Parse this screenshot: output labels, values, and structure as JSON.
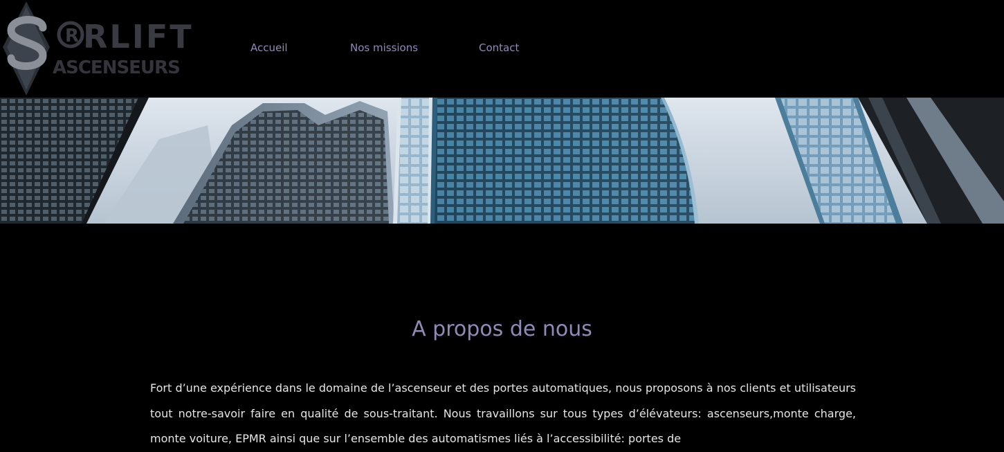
{
  "logo": {
    "name_top": "RLIFT",
    "name_bottom": "ASCENSEURS"
  },
  "nav": {
    "items": [
      {
        "label": "Accueil"
      },
      {
        "label": "Nos missions"
      },
      {
        "label": "Contact"
      }
    ]
  },
  "about": {
    "title": "A propos de nous",
    "paragraph": "Fort d’une expérience dans le domaine de l’ascenseur et des portes automatiques, nous proposons à nos clients et utilisateurs tout notre-savoir faire en qualité de sous-traitant. Nous travaillons sur tous types d’élévateurs: ascenseurs,monte charge, monte voiture, EPMR ainsi que sur l’ensemble des automatismes liés à l’accessibilité: portes de"
  },
  "colors": {
    "background": "#000000",
    "nav_link": "#8f8ab8",
    "title": "#8f8ab8",
    "body_text": "#e6e6e6"
  }
}
